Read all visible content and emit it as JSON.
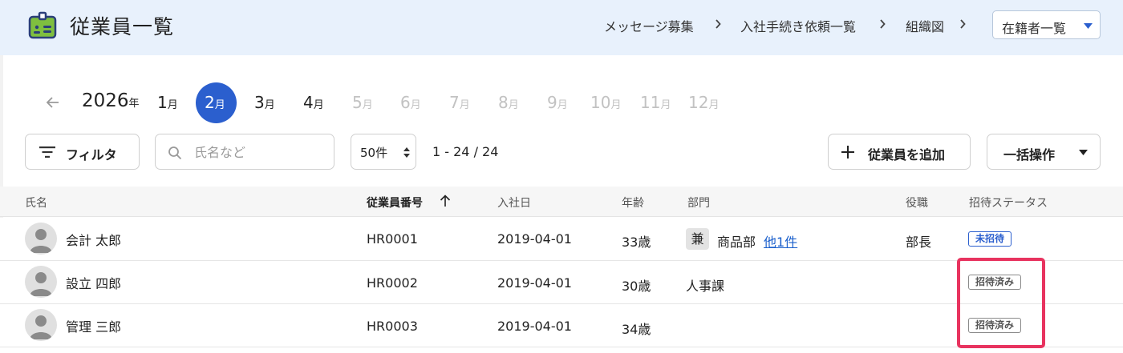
{
  "header": {
    "title": "従業員一覧",
    "breadcrumbs": [
      "メッセージ募集",
      "入社手続き依頼一覧",
      "組織図"
    ],
    "employee_filter": "在籍者一覧"
  },
  "calendar": {
    "year": "2026",
    "year_unit": "年",
    "month_unit": "月",
    "months": [
      "1",
      "2",
      "3",
      "4",
      "5",
      "6",
      "7",
      "8",
      "9",
      "10",
      "11",
      "12"
    ],
    "selected_month": "2",
    "enabled_months": [
      "1",
      "2",
      "3",
      "4"
    ]
  },
  "toolbar": {
    "filter_label": "フィルタ",
    "search_placeholder": "氏名など",
    "per_page": "50件",
    "range": "1 - 24 / 24",
    "add_label": "従業員を追加",
    "bulk_label": "一括操作"
  },
  "table": {
    "columns": [
      "氏名",
      "従業員番号",
      "入社日",
      "年齢",
      "部門",
      "役職",
      "招待ステータス"
    ],
    "sorted_column": "従業員番号",
    "rows": [
      {
        "name": "会計 太郎",
        "emp_no": "HR0001",
        "join_date": "2019-04-01",
        "age": "33歳",
        "dept_badge": "兼",
        "dept": "商品部",
        "dept_more": "他1件",
        "title": "部長",
        "status": "未招待",
        "status_style": "blue"
      },
      {
        "name": "設立 四郎",
        "emp_no": "HR0002",
        "join_date": "2019-04-01",
        "age": "30歳",
        "dept_badge": "",
        "dept": "人事課",
        "dept_more": "",
        "title": "",
        "status": "招待済み",
        "status_style": "gray"
      },
      {
        "name": "管理 三郎",
        "emp_no": "HR0003",
        "join_date": "2019-04-01",
        "age": "34歳",
        "dept_badge": "",
        "dept": "",
        "dept_more": "",
        "title": "",
        "status": "招待済み",
        "status_style": "gray"
      }
    ]
  },
  "colors": {
    "header_bg": "#e8f1fc",
    "accent": "#2b5fce",
    "highlight": "#e8335f"
  }
}
